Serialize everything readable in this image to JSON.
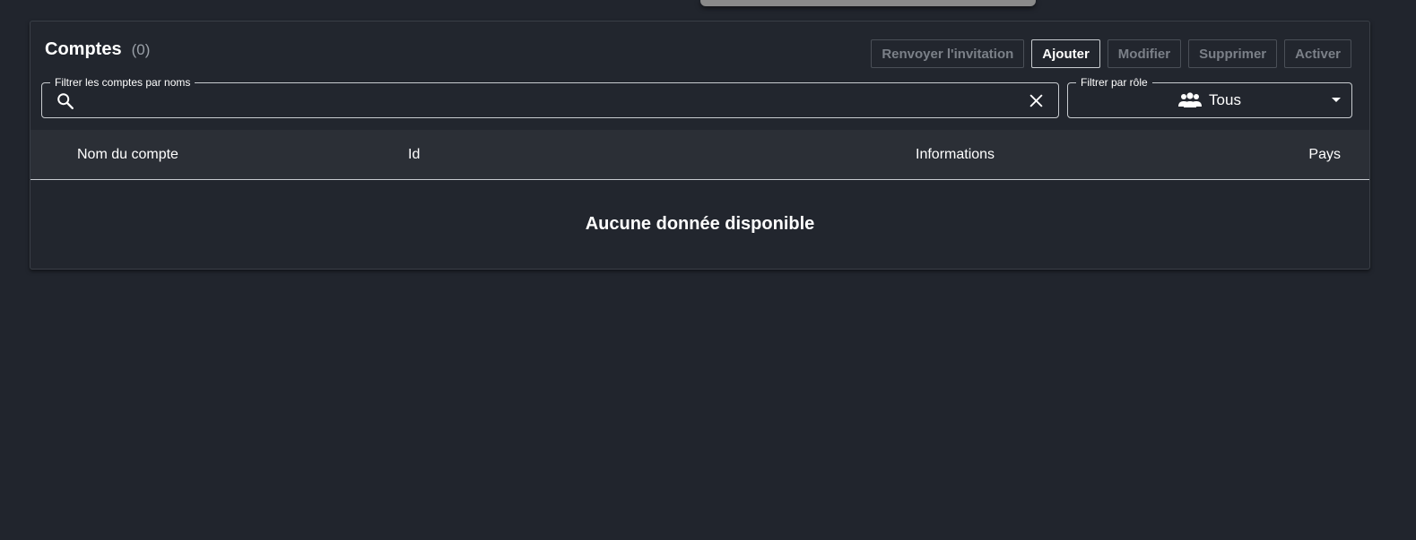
{
  "panel": {
    "title": "Comptes",
    "count": "(0)"
  },
  "toolbar": {
    "resend_label": "Renvoyer l'invitation",
    "add_label": "Ajouter",
    "edit_label": "Modifier",
    "delete_label": "Supprimer",
    "activate_label": "Activer"
  },
  "search": {
    "legend": "Filtrer les comptes par noms",
    "value": "",
    "icon": "search-icon",
    "clear_icon": "close-icon"
  },
  "role_filter": {
    "legend": "Filtrer par rôle",
    "selected": "Tous",
    "icon": "group-icon"
  },
  "table": {
    "columns": [
      "Nom du compte",
      "Id",
      "Informations",
      "Pays"
    ],
    "empty_text": "Aucune donnée disponible"
  },
  "colors": {
    "background": "#21252d",
    "header": "#2b2f36",
    "disabled_text": "#7b8088",
    "text": "#ffffff"
  }
}
